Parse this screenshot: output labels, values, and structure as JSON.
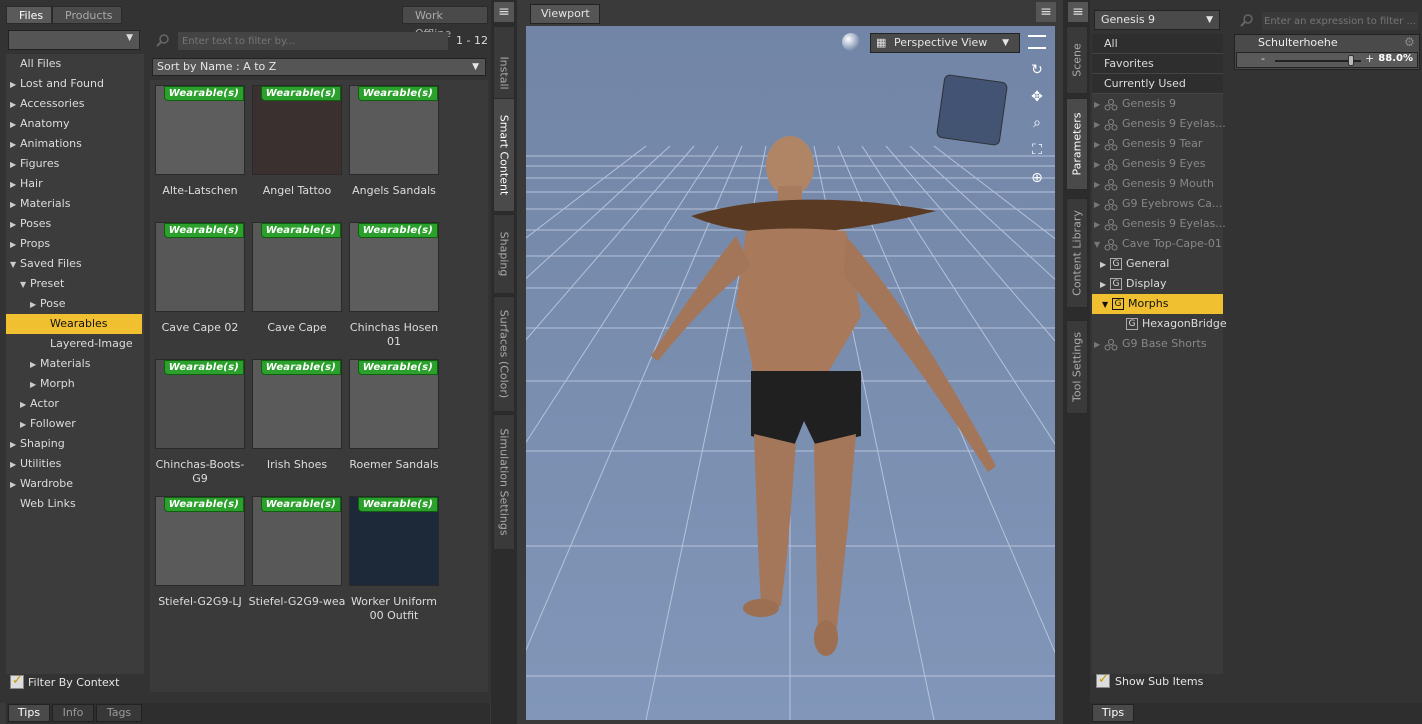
{
  "left": {
    "tabs": [
      "Files",
      "Products"
    ],
    "work_offline": "Work Offline",
    "filter_placeholder": "Enter text to filter by...",
    "range": "1 - 12",
    "sort": "Sort by Name : A to Z",
    "tree": [
      {
        "label": "All Files",
        "indent": 0,
        "arrow": ""
      },
      {
        "label": "Lost and Found",
        "indent": 0,
        "arrow": "▶"
      },
      {
        "label": "Accessories",
        "indent": 0,
        "arrow": "▶"
      },
      {
        "label": "Anatomy",
        "indent": 0,
        "arrow": "▶"
      },
      {
        "label": "Animations",
        "indent": 0,
        "arrow": "▶"
      },
      {
        "label": "Figures",
        "indent": 0,
        "arrow": "▶"
      },
      {
        "label": "Hair",
        "indent": 0,
        "arrow": "▶"
      },
      {
        "label": "Materials",
        "indent": 0,
        "arrow": "▶"
      },
      {
        "label": "Poses",
        "indent": 0,
        "arrow": "▶"
      },
      {
        "label": "Props",
        "indent": 0,
        "arrow": "▶"
      },
      {
        "label": "Saved Files",
        "indent": 0,
        "arrow": "▼"
      },
      {
        "label": "Preset",
        "indent": 1,
        "arrow": "▼"
      },
      {
        "label": "Pose",
        "indent": 2,
        "arrow": "▶"
      },
      {
        "label": "Wearables",
        "indent": 2,
        "arrow": ""
      },
      {
        "label": "Layered-Image",
        "indent": 2,
        "arrow": ""
      },
      {
        "label": "Materials",
        "indent": 2,
        "arrow": "▶"
      },
      {
        "label": "Morph",
        "indent": 2,
        "arrow": "▶"
      },
      {
        "label": "Actor",
        "indent": 1,
        "arrow": "▶"
      },
      {
        "label": "Follower",
        "indent": 1,
        "arrow": "▶"
      },
      {
        "label": "Shaping",
        "indent": 0,
        "arrow": "▶"
      },
      {
        "label": "Utilities",
        "indent": 0,
        "arrow": "▶"
      },
      {
        "label": "Wardrobe",
        "indent": 0,
        "arrow": "▶"
      },
      {
        "label": "Web Links",
        "indent": 0,
        "arrow": ""
      }
    ],
    "selected_index": 13,
    "badge": "Wearable(s)",
    "items": [
      {
        "label": "Alte-Latschen"
      },
      {
        "label": "Angel Tattoo"
      },
      {
        "label": "Angels Sandals"
      },
      {
        "label": "Cave Cape 02"
      },
      {
        "label": "Cave Cape"
      },
      {
        "label": "Chinchas Hosen 01"
      },
      {
        "label": "Chinchas-Boots-G9"
      },
      {
        "label": "Irish Shoes"
      },
      {
        "label": "Roemer Sandals"
      },
      {
        "label": "Stiefel-G2G9-LJ"
      },
      {
        "label": "Stiefel-G2G9-wea"
      },
      {
        "label": "Worker Uniform 00 Outfit"
      }
    ],
    "filter_by_context": "Filter By Context",
    "bottom_tabs": [
      "Tips",
      "Info",
      "Tags"
    ]
  },
  "vtabs_left": [
    "Install",
    "Smart Content",
    "Shaping",
    "Surfaces (Color)",
    "Simulation Settings"
  ],
  "viewport": {
    "tab": "Viewport",
    "view": "Perspective View"
  },
  "vtabs_right": [
    "Scene",
    "Parameters",
    "Content Library",
    "Tool Settings"
  ],
  "right": {
    "figure": "Genesis 9",
    "filter_placeholder": "Enter an expression to filter ...",
    "nodes": [
      {
        "label": "All",
        "type": "header"
      },
      {
        "label": "Favorites",
        "type": "header"
      },
      {
        "label": "Currently Used",
        "type": "header"
      },
      {
        "label": "Genesis 9",
        "type": "fig"
      },
      {
        "label": "Genesis 9 Eyelas...",
        "type": "fig"
      },
      {
        "label": "Genesis 9 Tear",
        "type": "fig"
      },
      {
        "label": "Genesis 9 Eyes",
        "type": "fig"
      },
      {
        "label": "Genesis 9 Mouth",
        "type": "fig"
      },
      {
        "label": "G9 Eyebrows Ca...",
        "type": "fig"
      },
      {
        "label": "Genesis 9 Eyelas...",
        "type": "fig"
      },
      {
        "label": "Cave Top-Cape-01",
        "type": "figopen"
      },
      {
        "label": "General",
        "type": "group"
      },
      {
        "label": "Display",
        "type": "group"
      },
      {
        "label": "Morphs",
        "type": "groupsel"
      },
      {
        "label": "HexagonBridge",
        "type": "leaf"
      },
      {
        "label": "G9 Base Shorts",
        "type": "fig"
      }
    ],
    "param_name": "Schulterhoehe",
    "param_value": "88.0%",
    "param_fraction": 0.88,
    "show_sub_items": "Show Sub Items",
    "bottom_tab": "Tips"
  }
}
